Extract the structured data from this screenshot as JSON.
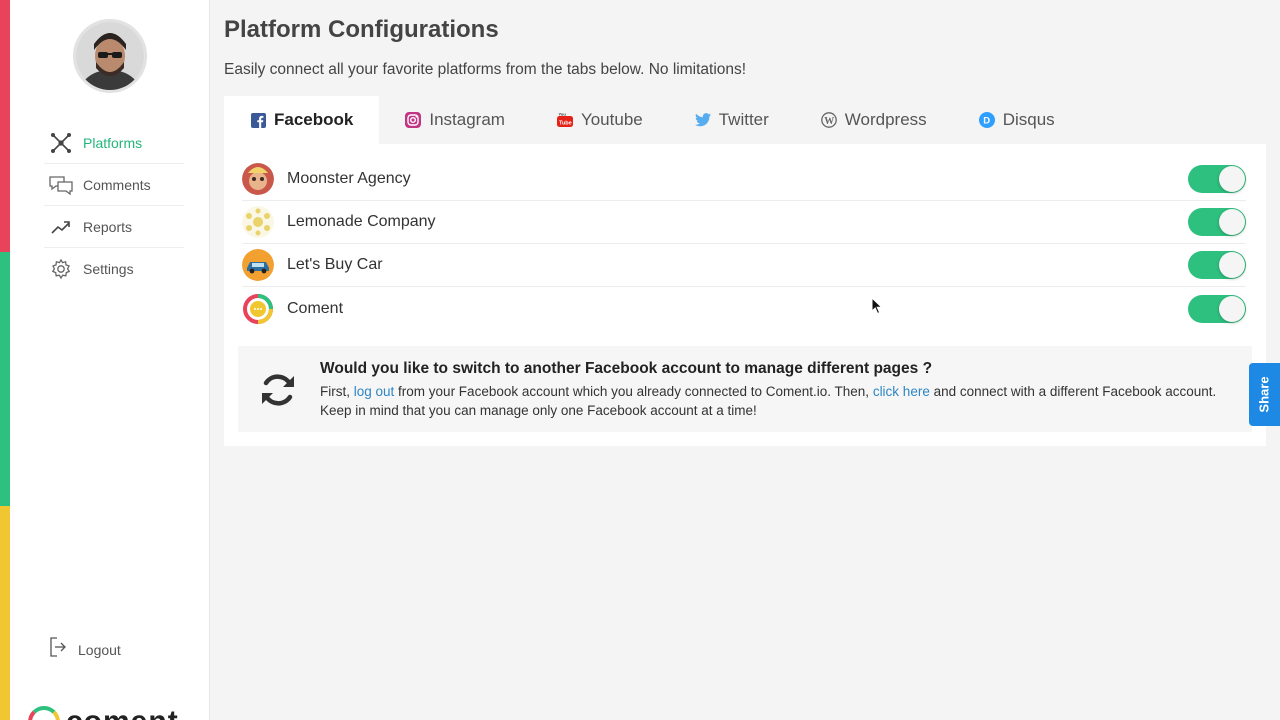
{
  "page": {
    "title": "Platform Configurations",
    "subtitle": "Easily connect all your favorite platforms from the tabs below. No limitations!"
  },
  "sidebar": {
    "items": [
      {
        "label": "Platforms",
        "icon": "network-icon",
        "active": true
      },
      {
        "label": "Comments",
        "icon": "chat-bubbles-icon",
        "active": false
      },
      {
        "label": "Reports",
        "icon": "trend-up-icon",
        "active": false
      },
      {
        "label": "Settings",
        "icon": "gear-icon",
        "active": false
      }
    ],
    "logout_label": "Logout",
    "brand_text": "coment"
  },
  "tabs": [
    {
      "label": "Facebook",
      "icon": "facebook-icon",
      "color": "#3b5998",
      "active": true
    },
    {
      "label": "Instagram",
      "icon": "instagram-icon",
      "color": "#c13584",
      "active": false
    },
    {
      "label": "Youtube",
      "icon": "youtube-icon",
      "color": "#e62117",
      "active": false
    },
    {
      "label": "Twitter",
      "icon": "twitter-icon",
      "color": "#55acee",
      "active": false
    },
    {
      "label": "Wordpress",
      "icon": "wordpress-icon",
      "color": "#666666",
      "active": false
    },
    {
      "label": "Disqus",
      "icon": "disqus-icon",
      "color": "#2e9fff",
      "active": false
    }
  ],
  "accounts": [
    {
      "name": "Moonster Agency",
      "enabled": true
    },
    {
      "name": "Lemonade Company",
      "enabled": true
    },
    {
      "name": "Let's Buy Car",
      "enabled": true
    },
    {
      "name": "Coment",
      "enabled": true
    }
  ],
  "notice": {
    "title": "Would you like to switch to another Facebook account to manage different pages ?",
    "text_1": "First, ",
    "link_1": "log out",
    "text_2": " from your Facebook account which you already connected to Coment.io. Then, ",
    "link_2": "click here",
    "text_3": " and connect with a different Facebook account. Keep in mind that you can manage only one Facebook account at a time!"
  },
  "share_label": "Share",
  "colors": {
    "accent": "#2ec07f",
    "stripe_red": "#e8435a",
    "stripe_green": "#2ec07f",
    "stripe_yellow": "#f0c631",
    "link": "#2f86c4",
    "share": "#1e88e5"
  }
}
